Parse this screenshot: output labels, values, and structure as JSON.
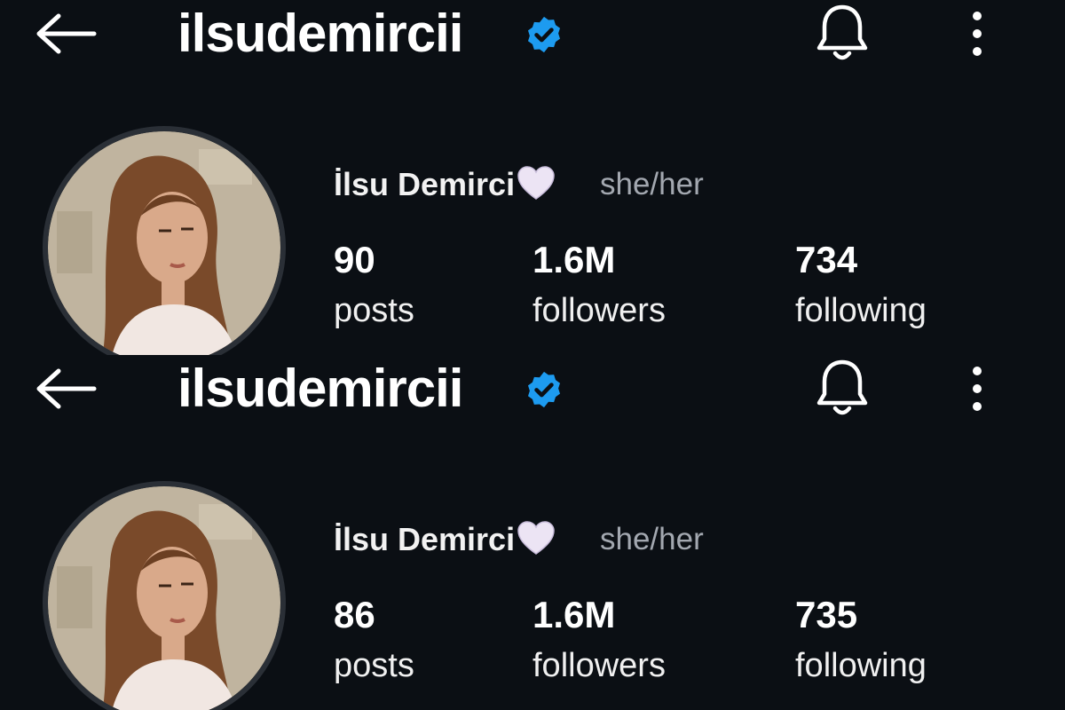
{
  "colors": {
    "background": "#0b0f14",
    "verified_blue": "#1d9bf0",
    "secondary_text": "#a3a8b0",
    "avatar_ring": "#2a2f36"
  },
  "icons": {
    "back": "arrow-left-icon",
    "verified": "verified-badge-icon",
    "notifications": "bell-icon",
    "menu": "more-vertical-icon",
    "emoji": "white-heart-icon"
  },
  "snapshots": [
    {
      "header": {
        "username": "ilsudemircii"
      },
      "profile": {
        "display_name": "İlsu Demirci",
        "pronouns": "she/her",
        "stats": {
          "posts": {
            "value": "90",
            "label": "posts"
          },
          "followers": {
            "value": "1.6M",
            "label": "followers"
          },
          "following": {
            "value": "734",
            "label": "following"
          }
        }
      }
    },
    {
      "header": {
        "username": "ilsudemircii"
      },
      "profile": {
        "display_name": "İlsu Demirci",
        "pronouns": "she/her",
        "stats": {
          "posts": {
            "value": "86",
            "label": "posts"
          },
          "followers": {
            "value": "1.6M",
            "label": "followers"
          },
          "following": {
            "value": "735",
            "label": "following"
          }
        }
      }
    }
  ]
}
